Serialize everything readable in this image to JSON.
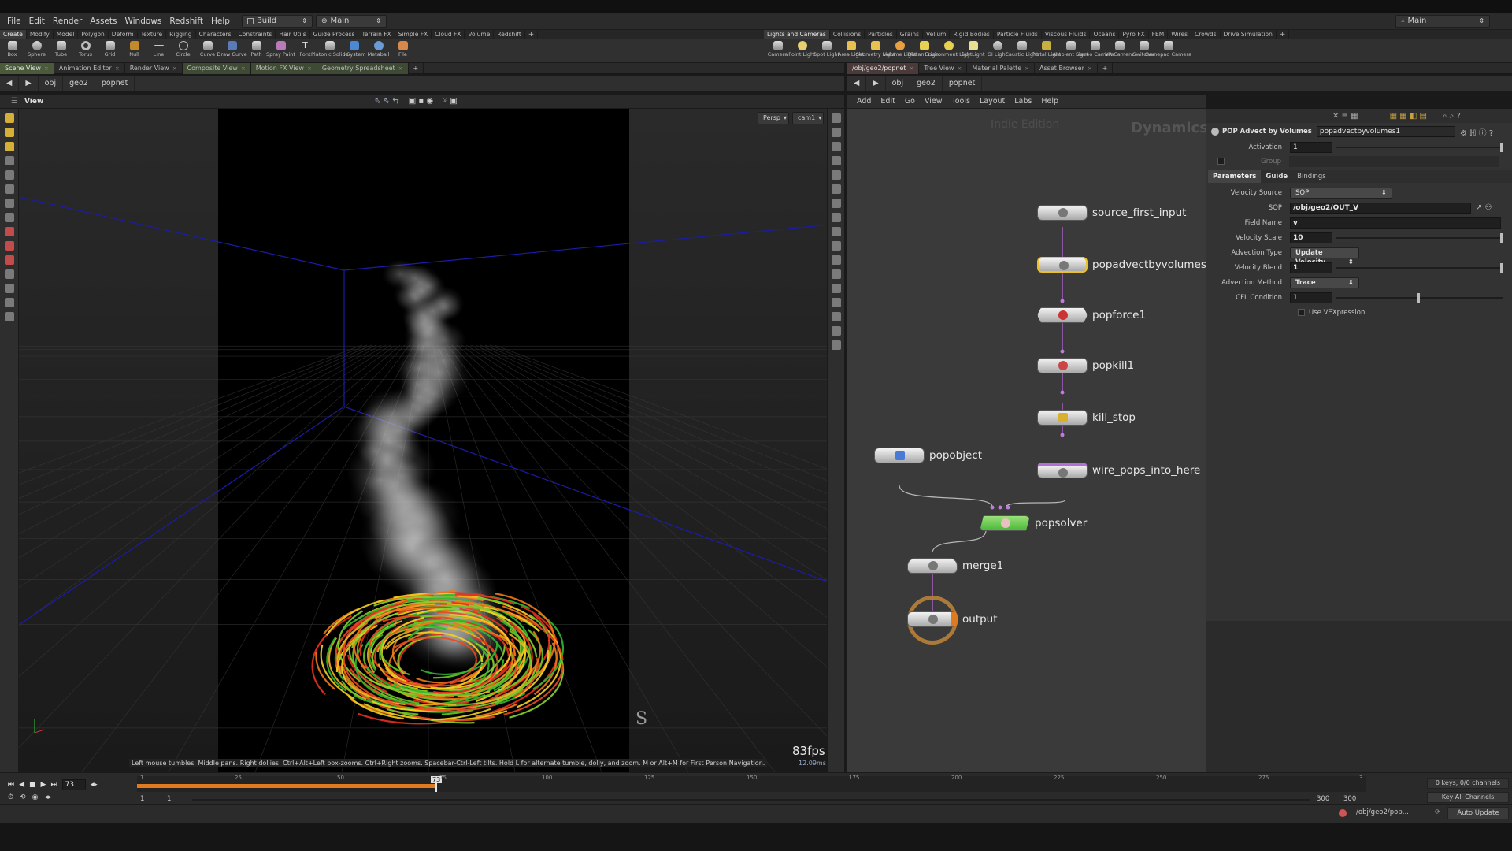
{
  "menu": {
    "items": [
      "File",
      "Edit",
      "Render",
      "Assets",
      "Windows",
      "Redshift",
      "Help"
    ],
    "desktop": "Build",
    "context": "Main",
    "right_context": "Main"
  },
  "shelf_tabs_left": [
    "Create",
    "Modify",
    "Model",
    "Polygon",
    "Deform",
    "Texture",
    "Rigging",
    "Characters",
    "Constraints",
    "Hair Utils",
    "Guide Process",
    "Terrain FX",
    "Simple FX",
    "Cloud FX",
    "Volume",
    "Redshift"
  ],
  "shelf_tabs_right": [
    "Lights and Cameras",
    "Collisions",
    "Particles",
    "Grains",
    "Vellum",
    "Rigid Bodies",
    "Particle Fluids",
    "Viscous Fluids",
    "Oceans",
    "Pyro FX",
    "FEM",
    "Wires",
    "Crowds",
    "Drive Simulation"
  ],
  "shelf_tools_left": [
    "Box",
    "Sphere",
    "Tube",
    "Torus",
    "Grid",
    "Null",
    "Line",
    "Circle",
    "Curve",
    "Draw Curve",
    "Path",
    "Spray Paint",
    "Font",
    "Platonic Solids",
    "L-System",
    "Metaball",
    "File"
  ],
  "shelf_tools_right": [
    "Camera",
    "Point Light",
    "Spot Light",
    "Area Light",
    "Geometry Light",
    "Volume Light",
    "Distant Light",
    "Environment Light",
    "Sky Light",
    "GI Light",
    "Caustic Light",
    "Portal Light",
    "Ambient Light",
    "Stereo Camera",
    "VR Camera",
    "Switcher",
    "Gamepad Camera"
  ],
  "left_pane": {
    "tabs": [
      "Scene View",
      "Animation Editor",
      "Render View",
      "Composite View",
      "Motion FX View",
      "Geometry Spreadsheet"
    ],
    "path": [
      "obj",
      "geo2",
      "popnet"
    ],
    "view_label": "View",
    "persp": "Persp",
    "cam": "cam1",
    "fps": "83fps",
    "ms": "12.09ms",
    "hint": "Left mouse tumbles. Middle pans. Right dollies. Ctrl+Alt+Left box-zooms. Ctrl+Right zooms. Spacebar-Ctrl-Left tilts. Hold L for alternate tumble, dolly, and zoom.    M or Alt+M for First Person Navigation.",
    "axis_letter": "S"
  },
  "right_pane": {
    "tabs": [
      "/obj/geo2/popnet",
      "Tree View",
      "Material Palette",
      "Asset Browser"
    ],
    "path": [
      "obj",
      "geo2",
      "popnet"
    ],
    "net_menu": [
      "Add",
      "Edit",
      "Go",
      "View",
      "Tools",
      "Layout",
      "Labs",
      "Help"
    ],
    "watermark_edition": "Indie Edition",
    "watermark_context": "Dynamics"
  },
  "nodes": {
    "source_first_input": "source_first_input",
    "popadvectbyvolumes1": "popadvectbyvolumes1",
    "popforce1": "popforce1",
    "popkill1": "popkill1",
    "kill_stop": "kill_stop",
    "wire_pops_into_here": "wire_pops_into_here",
    "popobject": "popobject",
    "popsolver": "popsolver",
    "merge1": "merge1",
    "output": "output"
  },
  "params": {
    "node_type": "POP Advect by Volumes",
    "node_name": "popadvectbyvolumes1",
    "activation_label": "Activation",
    "activation": "1",
    "group_label": "Group",
    "tabs": [
      "Parameters",
      "Guide",
      "Bindings"
    ],
    "velocity_source_label": "Velocity Source",
    "velocity_source": "SOP",
    "sop_label": "SOP",
    "sop": "/obj/geo2/OUT_V",
    "field_name_label": "Field Name",
    "field_name": "v",
    "velocity_scale_label": "Velocity Scale",
    "velocity_scale": "10",
    "advection_type_label": "Advection Type",
    "advection_type": "Update Velocity",
    "velocity_blend_label": "Velocity Blend",
    "velocity_blend": "1",
    "advection_method_label": "Advection Method",
    "advection_method": "Trace",
    "cfl_label": "CFL Condition",
    "cfl": "1",
    "use_vex_label": "Use VEXpression"
  },
  "timeline": {
    "current_frame": "73",
    "ticks": [
      "1",
      "25",
      "50",
      "75",
      "100",
      "125",
      "150",
      "175",
      "200",
      "225",
      "250",
      "275",
      "3"
    ],
    "range_start": "1",
    "range_start2": "1",
    "range_end": "300",
    "range_end2": "300",
    "keys_info": "0 keys, 0/0 channels",
    "key_all": "Key All Channels",
    "frame_progress": 0.243
  },
  "status": {
    "path": "/obj/geo2/pop...",
    "auto_update": "Auto Update"
  }
}
